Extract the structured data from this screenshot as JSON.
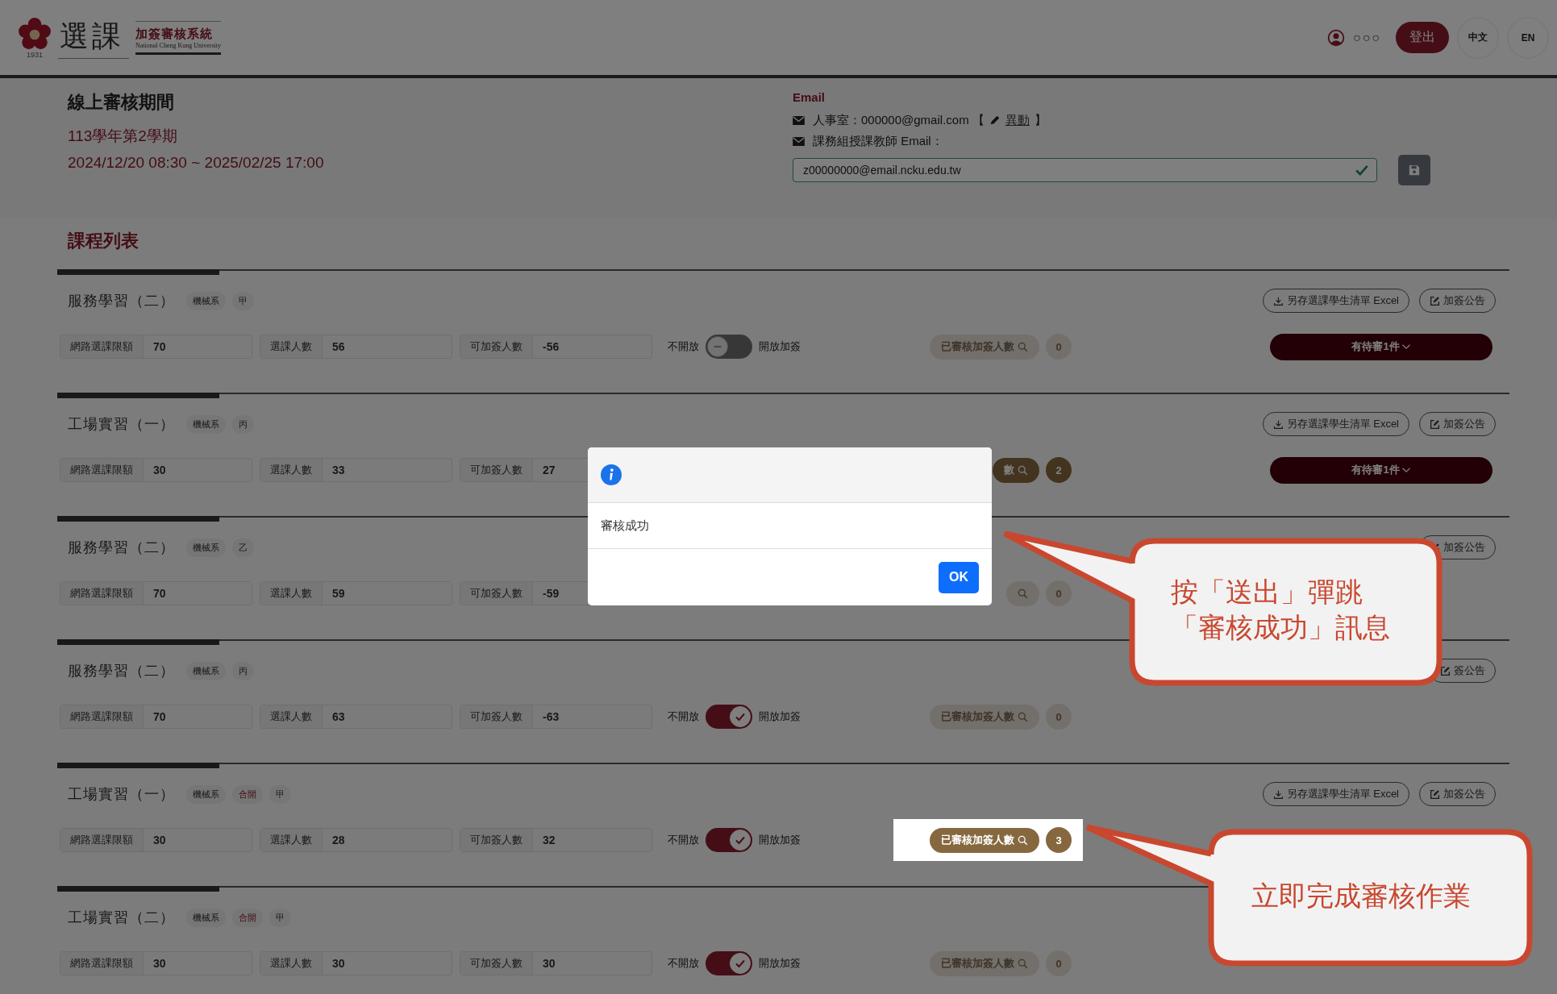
{
  "header": {
    "logo": {
      "title": "選課",
      "subtitle": "加簽審核系統",
      "english": "National Cheng Kung University",
      "year": "1931"
    },
    "user": "○○○",
    "logout": "登出",
    "languages": [
      {
        "label": "中文"
      },
      {
        "label": "EN"
      }
    ]
  },
  "review_period": {
    "heading": "線上審核期間",
    "term": "113學年第2學期",
    "range": "2024/12/20 08:30 ~ 2025/02/25 17:00"
  },
  "email": {
    "heading": "Email",
    "office": "人事室：000000@gmail.com 【",
    "change_link": "異動",
    "close": "】",
    "teacher_label": "課務組授課教師 Email：",
    "teacher_value": "z00000000@email.ncku.edu.tw",
    "valid": true
  },
  "course_list": {
    "heading": "課程列表",
    "courses": [
      {
        "name": "服務學習（二）",
        "tags": [
          {
            "label": "機械系",
            "accent": false
          },
          {
            "label": "甲",
            "accent": false
          }
        ],
        "fields": [
          {
            "label": "網路選課限額",
            "value": "70"
          },
          {
            "label": "選課人數",
            "value": "56"
          },
          {
            "label": "可加簽人數",
            "value": "-56"
          }
        ],
        "toggle": {
          "off_label": "不開放",
          "on_label": "開放加簽",
          "on": false
        },
        "reviewed": {
          "label": "已審核加簽人數",
          "count": "0",
          "active": false,
          "highlighted": false
        },
        "excel_button": "另存選課學生清單 Excel",
        "notice_button": "加簽公告",
        "pending": "有待審1件"
      },
      {
        "name": "工場實習（一）",
        "tags": [
          {
            "label": "機械系",
            "accent": false
          },
          {
            "label": "丙",
            "accent": false
          }
        ],
        "fields": [
          {
            "label": "網路選課限額",
            "value": "30"
          },
          {
            "label": "選課人數",
            "value": "33"
          },
          {
            "label": "可加簽人數",
            "value": "27"
          }
        ],
        "reviewed": {
          "label": "數",
          "count": "2",
          "active": true,
          "highlighted": false
        },
        "excel_button": "另存選課學生清單 Excel",
        "notice_button": "加簽公告",
        "pending": "有待審1件"
      },
      {
        "name": "服務學習（二）",
        "tags": [
          {
            "label": "機械系",
            "accent": false
          },
          {
            "label": "乙",
            "accent": false
          }
        ],
        "fields": [
          {
            "label": "網路選課限額",
            "value": "70"
          },
          {
            "label": "選課人數",
            "value": "59"
          },
          {
            "label": "可加簽人數",
            "value": "-59"
          }
        ],
        "reviewed": {
          "count": "0",
          "active": false,
          "highlighted": false
        },
        "notice_button": "加簽公告"
      },
      {
        "name": "服務學習（二）",
        "tags": [
          {
            "label": "機械系",
            "accent": false
          },
          {
            "label": "丙",
            "accent": false
          }
        ],
        "fields": [
          {
            "label": "網路選課限額",
            "value": "70"
          },
          {
            "label": "選課人數",
            "value": "63"
          },
          {
            "label": "可加簽人數",
            "value": "-63"
          }
        ],
        "toggle": {
          "off_label": "不開放",
          "on_label": "開放加簽",
          "on": true
        },
        "reviewed": {
          "label": "已審核加簽人數",
          "count": "0",
          "active": false,
          "highlighted": false
        },
        "notice_button": "簽公告"
      },
      {
        "name": "工場實習（一）",
        "tags": [
          {
            "label": "機械系",
            "accent": false
          },
          {
            "label": "合開",
            "accent": true
          },
          {
            "label": "甲",
            "accent": false
          }
        ],
        "fields": [
          {
            "label": "網路選課限額",
            "value": "30"
          },
          {
            "label": "選課人數",
            "value": "28"
          },
          {
            "label": "可加簽人數",
            "value": "32"
          }
        ],
        "toggle": {
          "off_label": "不開放",
          "on_label": "開放加簽",
          "on": true
        },
        "reviewed": {
          "label": "已審核加簽人數",
          "count": "3",
          "active": true,
          "highlighted": true
        },
        "excel_button": "另存選課學生清單 Excel",
        "notice_button": "加簽公告"
      },
      {
        "name": "工場實習（二）",
        "tags": [
          {
            "label": "機械系",
            "accent": false
          },
          {
            "label": "合開",
            "accent": true
          },
          {
            "label": "甲",
            "accent": false
          }
        ],
        "fields": [
          {
            "label": "網路選課限額",
            "value": "30"
          },
          {
            "label": "選課人數",
            "value": "30"
          },
          {
            "label": "可加簽人數",
            "value": "30"
          }
        ],
        "toggle": {
          "off_label": "不開放",
          "on_label": "開放加簽",
          "on": true
        },
        "reviewed": {
          "label": "已審核加簽人數",
          "count": "0",
          "active": false,
          "highlighted": false
        }
      }
    ]
  },
  "dialog": {
    "message": "審核成功",
    "button": "OK"
  },
  "callouts": [
    {
      "lines": [
        "按「送出」彈跳",
        "「審核成功」訊息"
      ]
    },
    {
      "lines": [
        "立即完成審核作業"
      ]
    }
  ]
}
